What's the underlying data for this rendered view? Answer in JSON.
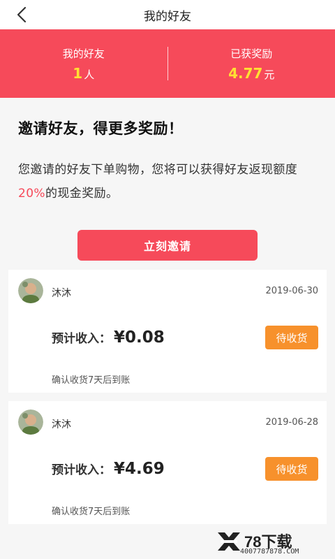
{
  "header": {
    "title": "我的好友",
    "back_icon": "chevron-left-icon"
  },
  "stats": {
    "friends_label": "我的好友",
    "friends_count": "1",
    "friends_unit": "人",
    "reward_label": "已获奖励",
    "reward_amount": "4.77",
    "reward_unit": "元"
  },
  "invite": {
    "title": "邀请好友，得更多奖励！",
    "desc_prefix": "您邀请的好友下单购物，您将可以获得好友返现额度",
    "desc_percent": "20%",
    "desc_suffix": "的现金奖励。",
    "button_label": "立刻邀请"
  },
  "records": [
    {
      "name": "沐沐",
      "date": "2019-06-30",
      "income_label": "预计收入：",
      "amount": "¥0.08",
      "status": "待收货",
      "note": "确认收货7天后到账"
    },
    {
      "name": "沐沐",
      "date": "2019-06-28",
      "income_label": "预计收入：",
      "amount": "¥4.69",
      "status": "待收货",
      "note": "确认收货7天后到账"
    }
  ],
  "watermark": {
    "text": "78下载",
    "sub": "4007787878.COM"
  },
  "colors": {
    "brand_red": "#f64a5a",
    "highlight_yellow": "#ffe033",
    "status_orange": "#f7912c"
  }
}
